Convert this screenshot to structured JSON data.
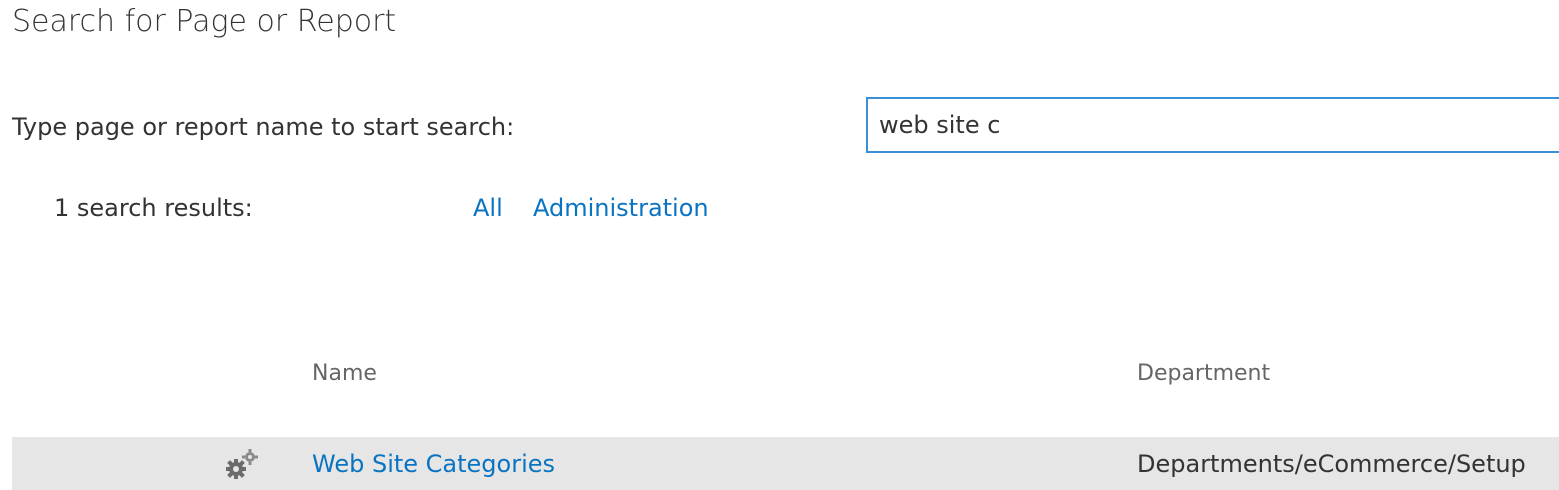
{
  "page": {
    "title": "Search for Page or Report"
  },
  "search": {
    "label": "Type page or report name to start search:",
    "value": "web site c"
  },
  "results": {
    "count_label": "1 search results:",
    "filters": [
      {
        "label": "All"
      },
      {
        "label": "Administration"
      }
    ]
  },
  "table": {
    "columns": {
      "name": "Name",
      "department": "Department"
    },
    "rows": [
      {
        "icon": "gears-icon",
        "name": "Web Site Categories",
        "department": "Departments/eCommerce/Setup"
      }
    ]
  },
  "colors": {
    "accent": "#0a74c2",
    "search_border": "#3a8fd6",
    "row_background": "#e6e6e6"
  }
}
